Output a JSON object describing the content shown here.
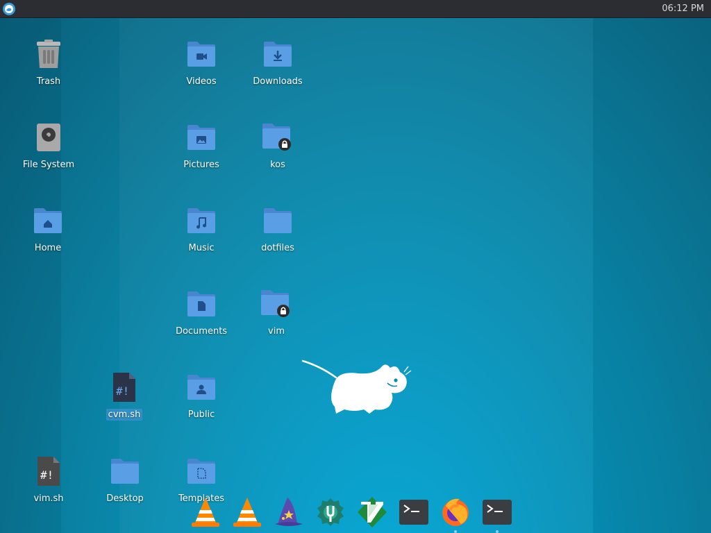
{
  "panel": {
    "menu_icon": "xfce-logo-icon",
    "clock": "06:12 PM"
  },
  "desktop": {
    "icons": {
      "trash": "Trash",
      "file_system": "File System",
      "home": "Home",
      "videos": "Videos",
      "downloads": "Downloads",
      "pictures": "Pictures",
      "kos": "kos",
      "music": "Music",
      "dotfiles": "dotfiles",
      "documents": "Documents",
      "vim": "vim",
      "cvm_sh": "cvm.sh",
      "public": "Public",
      "vim_sh": "vim.sh",
      "desktop": "Desktop",
      "templates": "Templates"
    }
  },
  "dock": {
    "items": [
      "vlc-icon",
      "vlc-icon",
      "wizard-icon",
      "settings-manager-icon",
      "vim-icon",
      "terminal-icon",
      "firefox-icon",
      "terminal-icon"
    ]
  },
  "colors": {
    "folder": "#5a9ee6",
    "folder_tab": "#4a86cf",
    "panel": "#2b2d33",
    "wallpaper": "#0792b9"
  }
}
